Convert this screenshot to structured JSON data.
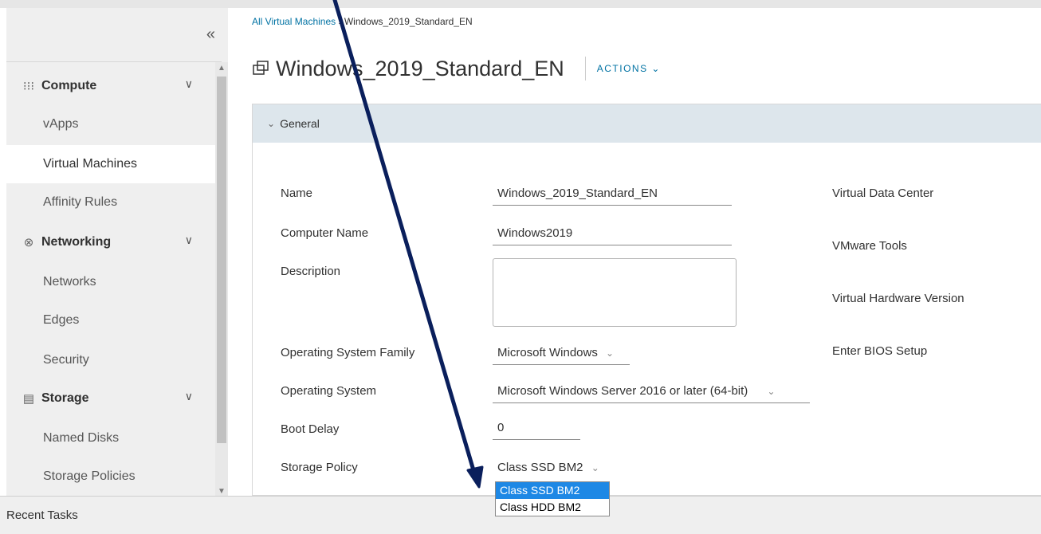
{
  "sidebar": {
    "collapse_glyph": "«",
    "groups": [
      {
        "label": "Compute",
        "icon": "compute-icon",
        "items": [
          {
            "label": "vApps"
          },
          {
            "label": "Virtual Machines",
            "active": true
          },
          {
            "label": "Affinity Rules"
          }
        ]
      },
      {
        "label": "Networking",
        "icon": "networking-icon",
        "items": [
          {
            "label": "Networks"
          },
          {
            "label": "Edges"
          },
          {
            "label": "Security"
          }
        ]
      },
      {
        "label": "Storage",
        "icon": "storage-icon",
        "items": [
          {
            "label": "Named Disks"
          },
          {
            "label": "Storage Policies"
          }
        ]
      }
    ]
  },
  "breadcrumb": {
    "link": "All Virtual Machines",
    "separator": "›",
    "current": "Windows_2019_Standard_EN"
  },
  "header": {
    "title": "Windows_2019_Standard_EN",
    "actions_label": "ACTIONS",
    "actions_chevron": "⌄"
  },
  "panel": {
    "title": "General",
    "chevron": "⌄"
  },
  "form": {
    "name_label": "Name",
    "name_value": "Windows_2019_Standard_EN",
    "computer_name_label": "Computer Name",
    "computer_name_value": "Windows2019",
    "description_label": "Description",
    "os_family_label": "Operating System Family",
    "os_family_value": "Microsoft Windows",
    "os_label": "Operating System",
    "os_value": "Microsoft Windows Server 2016 or later (64-bit)",
    "boot_delay_label": "Boot Delay",
    "boot_delay_value": "0",
    "storage_policy_label": "Storage Policy",
    "storage_policy_value": "Class SSD BM2",
    "select_chevron": "⌄"
  },
  "storage_policy_options": [
    "Class SSD BM2",
    "Class HDD BM2"
  ],
  "right_labels": {
    "vdc": "Virtual Data Center",
    "vmware_tools": "VMware Tools",
    "hw_version": "Virtual Hardware Version",
    "bios": "Enter BIOS Setup"
  },
  "footer": {
    "recent_tasks": "Recent Tasks"
  },
  "colors": {
    "link": "#0072a3",
    "arrow": "#0a1f5c",
    "dropdown_selected": "#1e88e5",
    "panel_header": "#dde6ec"
  }
}
